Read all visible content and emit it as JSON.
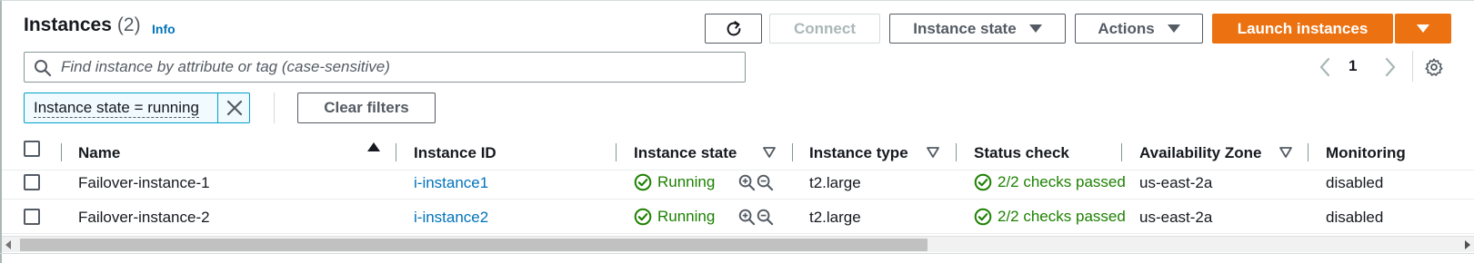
{
  "header": {
    "title": "Instances",
    "count": "(2)",
    "info_label": "Info"
  },
  "toolbar": {
    "refresh_icon": "refresh-icon",
    "connect_label": "Connect",
    "instance_state_label": "Instance state",
    "actions_label": "Actions",
    "launch_label": "Launch instances"
  },
  "search": {
    "placeholder": "Find instance by attribute or tag (case-sensitive)",
    "value": ""
  },
  "pagination": {
    "current_page": "1"
  },
  "filters": {
    "token_label": "Instance state = running",
    "clear_label": "Clear filters"
  },
  "table": {
    "columns": [
      "Name",
      "Instance ID",
      "Instance state",
      "Instance type",
      "Status check",
      "Availability Zone",
      "Monitoring"
    ],
    "rows": [
      {
        "name": "Failover-instance-1",
        "instance_id": "i-instance1",
        "state": "Running",
        "type": "t2.large",
        "status_check": "2/2 checks passed",
        "az": "us-east-2a",
        "monitoring": "disabled"
      },
      {
        "name": "Failover-instance-2",
        "instance_id": "i-instance2",
        "state": "Running",
        "type": "t2.large",
        "status_check": "2/2 checks passed",
        "az": "us-east-2a",
        "monitoring": "disabled"
      }
    ]
  },
  "colors": {
    "primary_orange": "#ec7211",
    "link_blue": "#0073bb",
    "success_green": "#1d8102",
    "token_border": "#00a1c9"
  }
}
